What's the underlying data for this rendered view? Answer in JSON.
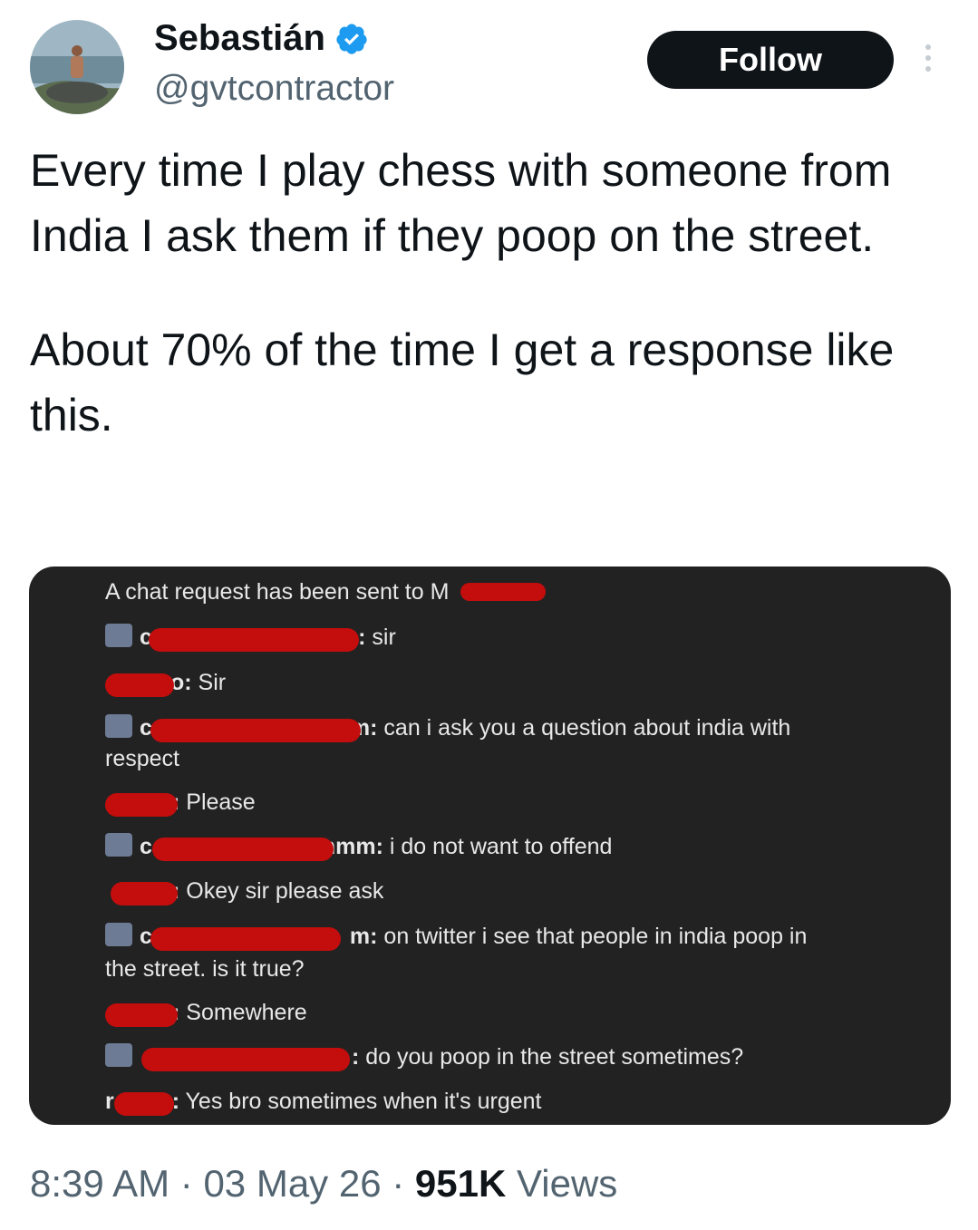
{
  "author": {
    "display_name": "Sebastián",
    "handle": "@gvtcontractor",
    "verified_icon": "verified-badge-icon",
    "follow_label": "Follow",
    "more_icon": "more-vertical-icon"
  },
  "tweet": {
    "paragraph_1": "Every time I play chess with someone from India I ask them if they poop on the street.",
    "paragraph_2": "About 70% of the time I get a response like this."
  },
  "chat": {
    "header": "A chat request has been sent to M",
    "lines": [
      {
        "prefix": "c",
        "suffix": "m:",
        "text": " sir"
      },
      {
        "prefix": "",
        "suffix": "o:",
        "text": " Sir"
      },
      {
        "prefix": "c",
        "suffix": "m:",
        "text": " can i ask you a question about india with"
      },
      {
        "text": "respect"
      },
      {
        "prefix": "",
        "suffix": ":",
        "text": " Please"
      },
      {
        "prefix": "c",
        "suffix": "mmm:",
        "text": " i do not want to offend"
      },
      {
        "prefix": "",
        "suffix": ":",
        "text": " Okey sir please ask"
      },
      {
        "prefix": "c",
        "suffix": "m:",
        "text": " on twitter i see that people in india poop in"
      },
      {
        "text": "the street. is it true?"
      },
      {
        "prefix": "",
        "suffix": ":",
        "text": " Somewhere"
      },
      {
        "prefix": "",
        "suffix": ":",
        "text": " do you poop in the street sometimes?"
      },
      {
        "prefix": "r",
        "suffix": ":",
        "text": " Yes bro sometimes when it's urgent"
      }
    ]
  },
  "meta": {
    "time": "8:39 AM",
    "date": "03 May 26",
    "views_count": "951K",
    "views_label": "Views",
    "sep": "·"
  },
  "colors": {
    "follow_bg": "#0f1419",
    "verified": "#1d9bf0",
    "redaction": "#c40d0d",
    "chat_bg": "#222222"
  }
}
